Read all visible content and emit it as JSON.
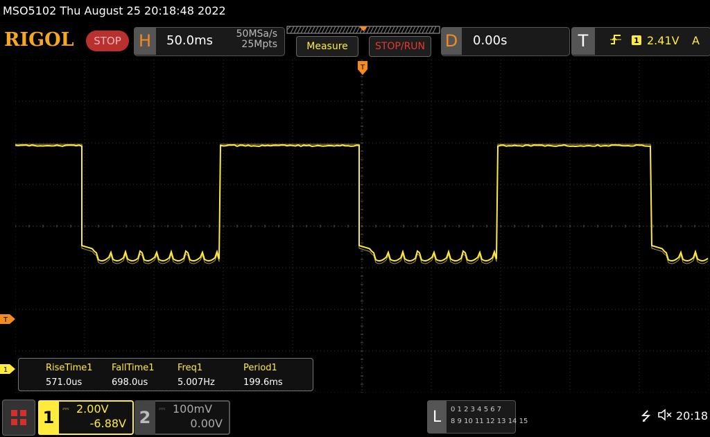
{
  "title_bar": {
    "text": "MSO5102  Thu August 25 20:18:48 2022"
  },
  "logo": "RIGOL",
  "run_state": "STOP",
  "horizontal": {
    "letter": "H",
    "timebase": "50.0ms",
    "sample_rate": "50MSa/s",
    "memory_depth": "25Mpts"
  },
  "buttons": {
    "measure": "Measure",
    "stop_run": "STOP/RUN"
  },
  "delay": {
    "letter": "D",
    "value": "0.00s"
  },
  "trigger": {
    "letter": "T",
    "slope_icon": "rising-edge-icon",
    "channel": "1",
    "level": "2.41V",
    "mode": "A"
  },
  "markers": {
    "trigger_position": "T",
    "trigger_level": "T",
    "channel1": "1"
  },
  "measurements": [
    {
      "label": "RiseTime1",
      "value": "571.0us"
    },
    {
      "label": "FallTime1",
      "value": "698.0us"
    },
    {
      "label": "Freq1",
      "value": "5.007Hz"
    },
    {
      "label": "Period1",
      "value": "199.6ms"
    }
  ],
  "channel1": {
    "number": "1",
    "coupling": "⎓",
    "scale": "2.00V",
    "offset": "-6.88V"
  },
  "channel2": {
    "number": "2",
    "coupling": "⎓",
    "scale": "100mV",
    "offset": "0.00V"
  },
  "logic": {
    "letter": "L",
    "row1": "0 1 2 3  4 5 6 7",
    "row2": "8 9 10 11 12 13 14 15"
  },
  "status": {
    "usb_icon": "usb-icon",
    "sound_icon": "speaker-muted-icon",
    "time": "20:18"
  },
  "colors": {
    "ch1": "#ffeb3b",
    "trigger": "#f58a1e",
    "stop": "#b8312f"
  }
}
